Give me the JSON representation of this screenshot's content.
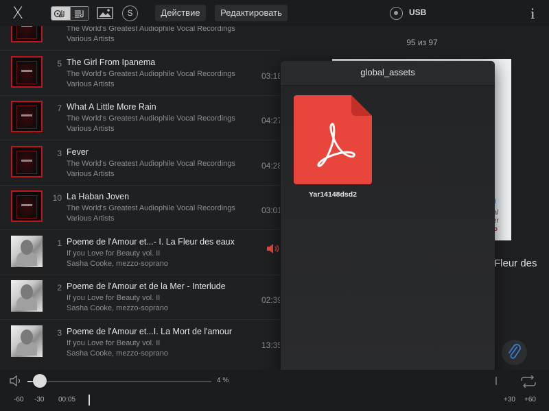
{
  "topbar": {
    "close_label": "X",
    "s_label": "S",
    "action_label": "Действие",
    "edit_label": "Редактировать",
    "source_label": "USB",
    "info_label": "i"
  },
  "tracks": [
    {
      "num": "",
      "title": "",
      "album": "The World's Greatest Audiophile Vocal Recordings",
      "artist": "Various Artists",
      "duration": "",
      "cover": "red"
    },
    {
      "num": "5",
      "title": "The Girl From Ipanema",
      "album": "The World's Greatest Audiophile Vocal Recordings",
      "artist": "Various Artists",
      "duration": "03:18",
      "cover": "red"
    },
    {
      "num": "7",
      "title": "What A Little More Rain",
      "album": "The World's Greatest Audiophile Vocal Recordings",
      "artist": "Various Artists",
      "duration": "04:27",
      "cover": "red"
    },
    {
      "num": "3",
      "title": "Fever",
      "album": "The World's Greatest Audiophile Vocal Recordings",
      "artist": "Various Artists",
      "duration": "04:28",
      "cover": "red"
    },
    {
      "num": "10",
      "title": "La Haban Joven",
      "album": "The World's Greatest Audiophile Vocal Recordings",
      "artist": "Various Artists",
      "duration": "03:01",
      "cover": "red"
    },
    {
      "num": "1",
      "title": "Poeme de l'Amour et...- I. La Fleur des eaux",
      "album": "If you Love for Beauty  vol. II",
      "artist": "Sasha Cooke, mezzo-soprano",
      "duration": "",
      "cover": "photo",
      "playing": true
    },
    {
      "num": "2",
      "title": "Poeme de l'Amour et de la Mer - Interlude",
      "album": "If you Love for Beauty  vol. II",
      "artist": "Sasha Cooke, mezzo-soprano",
      "duration": "02:39",
      "cover": "photo"
    },
    {
      "num": "3",
      "title": "Poeme de l'Amour et...I. La Mort de l'amour",
      "album": "If you Love for Beauty  vol. II",
      "artist": "Sasha Cooke, mezzo-soprano",
      "duration": "13:35",
      "cover": "photo"
    }
  ],
  "now_playing": {
    "counter": "95 из 97",
    "title_fragment": "Fleur des",
    "cover_fragments": [
      "e II",
      "nal",
      "ser",
      "io"
    ]
  },
  "popup": {
    "title": "global_assets",
    "file_name": "Yar14148dsd2",
    "file_icon": "pdf-icon"
  },
  "bottombar": {
    "volume_percent": "4 %",
    "volume_level": 0.04,
    "seek_labels": [
      "-60",
      "-30",
      "00:05",
      "+30",
      "+60"
    ]
  },
  "colors": {
    "accent": "#e8453c",
    "pdf_red": "#e8453c",
    "attach_blue": "#3b7dd8"
  }
}
